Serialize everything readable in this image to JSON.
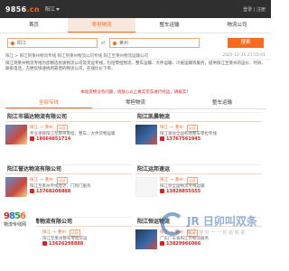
{
  "header": {
    "logo_main": "9856",
    "logo_suffix": ".cn",
    "city": "阳江",
    "user_links": "登录 | 注册"
  },
  "nav": [
    "首页",
    "零担物流",
    "整车运输",
    "物流公司"
  ],
  "search": {
    "from": "阳江",
    "to": "莱州",
    "swap": "⇄",
    "button": "搜索"
  },
  "breadcrumb": {
    "path": "阳江 > 阳江到莱州物流专线 阳江到莱州物流公司专线 阳江至莱州物流运输公司",
    "date": "2025-12-25 21:55:01"
  },
  "intro": "阳江到莱州物流专线为您精选优质物流公司及货运专线，包括零担物流、整车运输、大件运输、冷链运输等服务，提供阳江至莱州的运价、时效、联系电话，方便您快速找到靠谱的物流公司，在线比价下单。",
  "notice": "本站货物没有问题，请放心以上真实货车进行托运，请核实！",
  "tabs": [
    "全部专线",
    "零担物流",
    "整车运输"
  ],
  "cards": [
    {
      "title": "阳江市福达物流有限公司",
      "from": "阳江",
      "to": "莱州",
      "desc": "专业承接阳江至莱州零担、整车、大件货物运输",
      "tag": "认证",
      "phone": "18664851714"
    },
    {
      "title": "阳江凯晨物流",
      "from": "阳江",
      "to": "莱州",
      "desc": "阳江发往全国各地整车零担专线",
      "tag": "认证",
      "phone": "13767561945"
    },
    {
      "title": "阳江誉达物流有限公司",
      "from": "阳江",
      "to": "莱州",
      "desc": "阳江至莱州专线直达，门到门服务",
      "tag": "认证",
      "phone": "13768208888"
    },
    {
      "title": "阳江运邦速运",
      "from": "阳江",
      "to": "莱州",
      "desc": "阳江到全国物流专线运输",
      "tag": "认证",
      "phone": "13828855555"
    },
    {
      "title": "阳江广东南粤物流有限公司",
      "from": "阳江",
      "to": "莱州",
      "desc": "阳江至莱州整车零担货运",
      "tag": "认证",
      "phone": "13626298888"
    },
    {
      "title": "阳江恒运物流",
      "from": "阳江",
      "to": "莱州",
      "desc": "广东广东省阳江市物流服务",
      "tag": "认证",
      "phone": "13829966066"
    }
  ],
  "side_logo": {
    "num": [
      "9",
      "8",
      "5",
      "6"
    ],
    "sub": "物流专线网"
  },
  "watermark": {
    "title": "JR 日卯叫双条",
    "subtitle": "数 人 挂 交 一 一 的 动 收 录"
  },
  "colors": {
    "accent": "#f36c21",
    "header_bg": "#2f2f2f",
    "phone": "#e02020"
  }
}
